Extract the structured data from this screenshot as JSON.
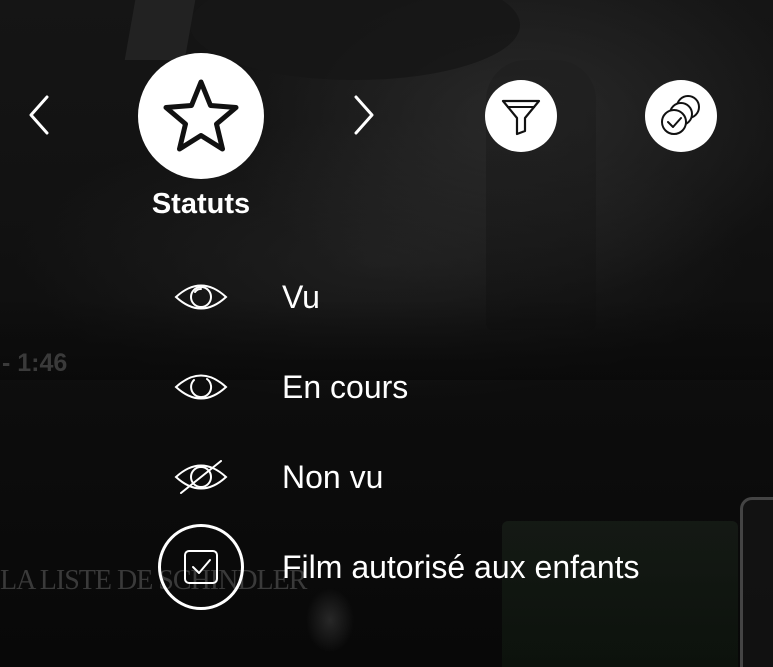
{
  "background": {
    "time_text": "- 1:46",
    "poster_text": "LA LISTE DE SCHINDLER"
  },
  "category": {
    "label": "Statuts",
    "icon": "star-icon"
  },
  "toolbar": {
    "filter_icon": "filter-icon",
    "coins_icon": "coins-check-icon"
  },
  "menu": {
    "items": [
      {
        "label": "Vu",
        "icon": "eye-icon"
      },
      {
        "label": "En cours",
        "icon": "eye-half-icon"
      },
      {
        "label": "Non vu",
        "icon": "eye-off-icon"
      },
      {
        "label": "Film autorisé aux enfants",
        "icon": "checkbox-icon"
      }
    ]
  },
  "colors": {
    "foreground": "#ffffff",
    "background": "#0a0a0a"
  }
}
